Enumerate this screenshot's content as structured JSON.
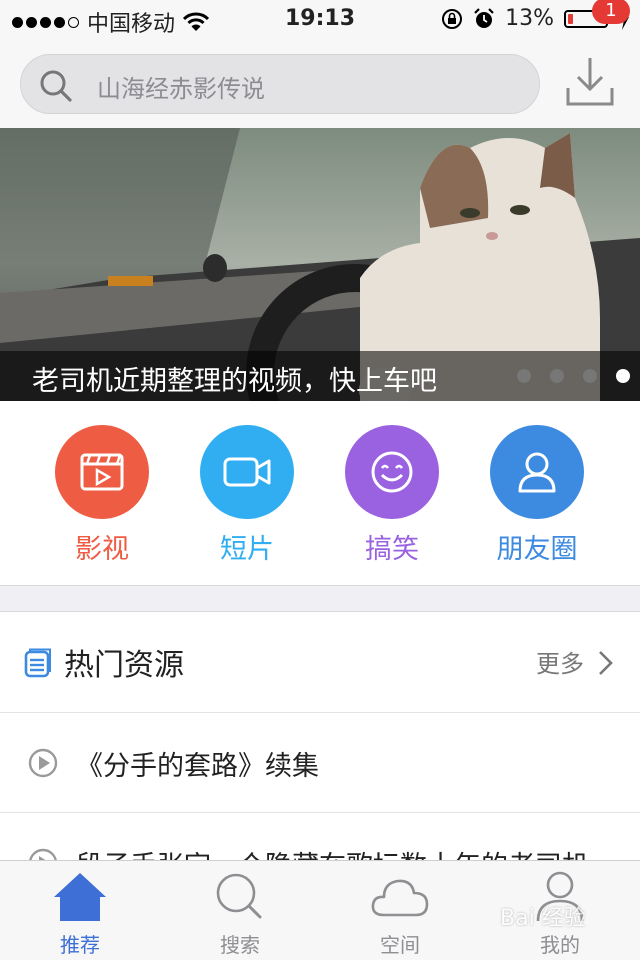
{
  "status_bar": {
    "carrier": "中国移动",
    "time": "19:13",
    "battery": "13%",
    "battery_level": 0.13
  },
  "search": {
    "placeholder": "山海经赤影传说"
  },
  "download": {
    "badge": "1"
  },
  "banner": {
    "caption": "老司机近期整理的视频，快上车吧",
    "page_count": 4,
    "active_page": 4
  },
  "categories": [
    {
      "label": "影视",
      "color": "#ee5c43",
      "icon": "film-icon"
    },
    {
      "label": "短片",
      "color": "#31aef1",
      "icon": "video-camera-icon"
    },
    {
      "label": "搞笑",
      "color": "#9a61e0",
      "icon": "smile-icon"
    },
    {
      "label": "朋友圈",
      "color": "#3d8be0",
      "icon": "user-icon"
    }
  ],
  "hot": {
    "title": "热门资源",
    "more": "更多",
    "items": [
      {
        "title": "《分手的套路》续集"
      },
      {
        "title": "段子手张宇一个隐藏在歌坛数十年的老司机"
      }
    ]
  },
  "tabs": [
    {
      "label": "推荐",
      "active": true
    },
    {
      "label": "搜索",
      "active": false
    },
    {
      "label": "空间",
      "active": false
    },
    {
      "label": "我的",
      "active": false
    }
  ],
  "watermark": "Bai 经验"
}
